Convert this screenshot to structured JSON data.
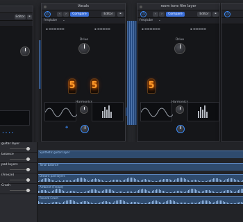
{
  "plugins": [
    {
      "title": "",
      "compare_label": "Compare",
      "editor_label": "Editor",
      "preset": "",
      "drive_label": "",
      "brand": "",
      "digits": []
    },
    {
      "title": "Vocals",
      "compare_label": "Compare",
      "editor_label": "Editor",
      "preset": "freqtube",
      "drive_label": "Drive",
      "harmonics_label": "Harmonics",
      "brand": "freqtube",
      "digits": [
        "5",
        "5"
      ]
    },
    {
      "title": "room tone film layer",
      "compare_label": "Compare",
      "editor_label": "Editor",
      "preset": "freqtube",
      "drive_label": "Drive",
      "harmonics_label": "Harmonics",
      "brand": "freqtube",
      "digits": [
        "5"
      ]
    },
    {
      "title": "",
      "compare_label": "",
      "editor_label": "",
      "preset": "",
      "brand": ""
    }
  ],
  "tracks": [
    {
      "name": "guitar layer"
    },
    {
      "name": "balance"
    },
    {
      "name": "pad layers"
    },
    {
      "name": "(Freeze)"
    },
    {
      "name": "Crash"
    }
  ],
  "clips": [
    {
      "label": "Synthetic guitar layer"
    },
    {
      "label": "Tonal balance"
    },
    {
      "label": "Distant pad layers"
    },
    {
      "label": "Ambient (Freeze)"
    },
    {
      "label": "Reverb Crash"
    }
  ],
  "colors": {
    "accent": "#3b6fd8",
    "tube_glow": "#ff9b2b",
    "clip_blue": "#2f4b6e"
  }
}
